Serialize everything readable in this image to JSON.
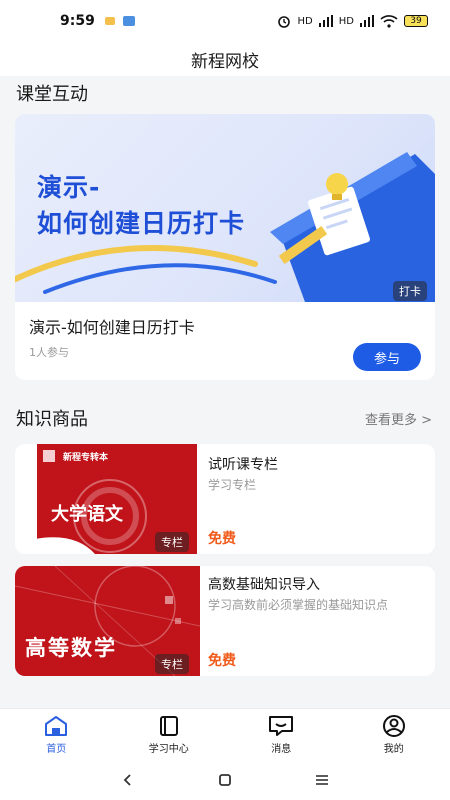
{
  "status": {
    "time": "9:59",
    "battery": "39",
    "net_a": "HD",
    "net_b": "HD"
  },
  "app": {
    "title": "新程网校"
  },
  "classroom": {
    "section_title": "课堂互动",
    "banner_line1": "演示-",
    "banner_line2": "如何创建日历打卡",
    "tag": "打卡",
    "title": "演示-如何创建日历打卡",
    "meta": "1人参与",
    "join_label": "参与"
  },
  "knowledge": {
    "section_title": "知识商品",
    "more_label": "查看更多 >",
    "items": [
      {
        "title": "试听课专栏",
        "subtitle": "学习专栏",
        "price": "免费",
        "tag": "专栏",
        "thumb_header": "新程专转本",
        "thumb_caption": "大学语文"
      },
      {
        "title": "高数基础知识导入",
        "subtitle": "学习高数前必须掌握的基础知识点",
        "price": "免费",
        "tag": "专栏",
        "thumb_caption": "高等数学"
      }
    ]
  },
  "tabbar": [
    {
      "label": "首页",
      "icon": "home-icon",
      "active": true
    },
    {
      "label": "学习中心",
      "icon": "book-icon",
      "active": false
    },
    {
      "label": "消息",
      "icon": "message-icon",
      "active": false
    },
    {
      "label": "我的",
      "icon": "user-icon",
      "active": false
    }
  ],
  "colors": {
    "primary": "#1f5ce6",
    "price": "#f05a1a",
    "banner_text": "#1f4fd6",
    "thumb_red": "#c0131a"
  }
}
